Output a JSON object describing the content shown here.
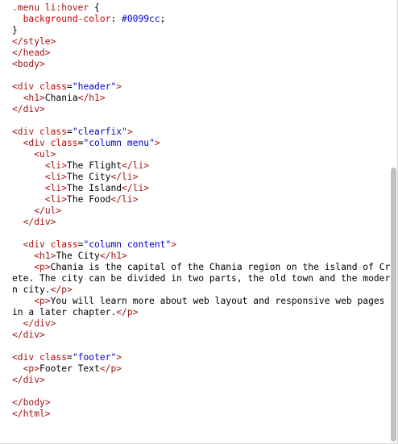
{
  "lines": [
    [
      {
        "t": ".menu li:hover",
        "c": "sel"
      },
      {
        "t": " {",
        "c": "text"
      }
    ],
    [
      {
        "t": "  background-color",
        "c": "prop"
      },
      {
        "t": ": ",
        "c": "text"
      },
      {
        "t": "#0099cc",
        "c": "val"
      },
      {
        "t": ";",
        "c": "text"
      }
    ],
    [
      {
        "t": "}",
        "c": "text"
      }
    ],
    [
      {
        "t": "</style>",
        "c": "tag"
      }
    ],
    [
      {
        "t": "</head>",
        "c": "tag"
      }
    ],
    [
      {
        "t": "<body>",
        "c": "tag"
      }
    ],
    [],
    [
      {
        "t": "<div",
        "c": "tag"
      },
      {
        "t": " class",
        "c": "attr"
      },
      {
        "t": "=",
        "c": "text"
      },
      {
        "t": "\"header\"",
        "c": "str"
      },
      {
        "t": ">",
        "c": "tag"
      }
    ],
    [
      {
        "t": "  <h1>",
        "c": "tag"
      },
      {
        "t": "Chania",
        "c": "text"
      },
      {
        "t": "</h1>",
        "c": "tag"
      }
    ],
    [
      {
        "t": "</div>",
        "c": "tag"
      }
    ],
    [],
    [
      {
        "t": "<div",
        "c": "tag"
      },
      {
        "t": " class",
        "c": "attr"
      },
      {
        "t": "=",
        "c": "text"
      },
      {
        "t": "\"clearfix\"",
        "c": "str"
      },
      {
        "t": ">",
        "c": "tag"
      }
    ],
    [
      {
        "t": "  <div",
        "c": "tag"
      },
      {
        "t": " class",
        "c": "attr"
      },
      {
        "t": "=",
        "c": "text"
      },
      {
        "t": "\"column menu\"",
        "c": "str"
      },
      {
        "t": ">",
        "c": "tag"
      }
    ],
    [
      {
        "t": "    <ul>",
        "c": "tag"
      }
    ],
    [
      {
        "t": "      <li>",
        "c": "tag"
      },
      {
        "t": "The Flight",
        "c": "text"
      },
      {
        "t": "</li>",
        "c": "tag"
      }
    ],
    [
      {
        "t": "      <li>",
        "c": "tag"
      },
      {
        "t": "The City",
        "c": "text"
      },
      {
        "t": "</li>",
        "c": "tag"
      }
    ],
    [
      {
        "t": "      <li>",
        "c": "tag"
      },
      {
        "t": "The Island",
        "c": "text"
      },
      {
        "t": "</li>",
        "c": "tag"
      }
    ],
    [
      {
        "t": "      <li>",
        "c": "tag"
      },
      {
        "t": "The Food",
        "c": "text"
      },
      {
        "t": "</li>",
        "c": "tag"
      }
    ],
    [
      {
        "t": "    </ul>",
        "c": "tag"
      }
    ],
    [
      {
        "t": "  </div>",
        "c": "tag"
      }
    ],
    [],
    [
      {
        "t": "  <div",
        "c": "tag"
      },
      {
        "t": " class",
        "c": "attr"
      },
      {
        "t": "=",
        "c": "text"
      },
      {
        "t": "\"column content\"",
        "c": "str"
      },
      {
        "t": ">",
        "c": "tag"
      }
    ],
    [
      {
        "t": "    <h1>",
        "c": "tag"
      },
      {
        "t": "The City",
        "c": "text"
      },
      {
        "t": "</h1>",
        "c": "tag"
      }
    ],
    [
      {
        "t": "    <p>",
        "c": "tag"
      },
      {
        "t": "Chania is the capital of the Chania region on the island of Crete. The city can be divided in two parts, the old town and the modern city.",
        "c": "text"
      },
      {
        "t": "</p>",
        "c": "tag"
      }
    ],
    [
      {
        "t": "    <p>",
        "c": "tag"
      },
      {
        "t": "You will learn more about web layout and responsive web pages in a later chapter.",
        "c": "text"
      },
      {
        "t": "</p>",
        "c": "tag"
      }
    ],
    [
      {
        "t": "  </div>",
        "c": "tag"
      }
    ],
    [
      {
        "t": "</div>",
        "c": "tag"
      }
    ],
    [],
    [
      {
        "t": "<div",
        "c": "tag"
      },
      {
        "t": " class",
        "c": "attr"
      },
      {
        "t": "=",
        "c": "text"
      },
      {
        "t": "\"footer\"",
        "c": "str"
      },
      {
        "t": ">",
        "c": "tag"
      }
    ],
    [
      {
        "t": "  <p>",
        "c": "tag"
      },
      {
        "t": "Footer Text",
        "c": "text"
      },
      {
        "t": "</p>",
        "c": "tag"
      }
    ],
    [
      {
        "t": "</div>",
        "c": "tag"
      }
    ],
    [],
    [
      {
        "t": "</body>",
        "c": "tag"
      }
    ],
    [
      {
        "t": "</html>",
        "c": "tag"
      }
    ]
  ]
}
